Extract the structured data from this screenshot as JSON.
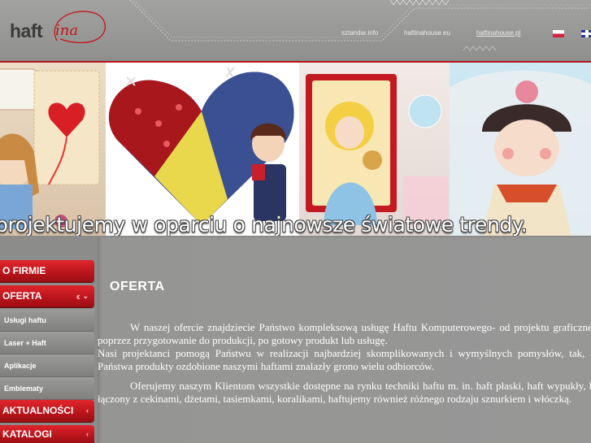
{
  "header": {
    "logo_word": "haft",
    "logo_script": "ina",
    "links": [
      "sztandar.info",
      "haftinahouse.eu",
      "haftinahouse.pl"
    ]
  },
  "banner": {
    "code": "09-030",
    "tagline": "projektujemy w oparciu o najnowsze światowe trendy."
  },
  "sidebar": {
    "items": [
      {
        "label": "O FIRMIE",
        "type": "main"
      },
      {
        "label": "OFERTA",
        "type": "main",
        "expanded": true
      },
      {
        "label": "Usługi haftu",
        "type": "sub"
      },
      {
        "label": "Laser + Haft",
        "type": "sub"
      },
      {
        "label": "Aplikacje",
        "type": "sub"
      },
      {
        "label": "Emblematy",
        "type": "sub"
      },
      {
        "label": "AKTUALNOŚCI",
        "type": "main"
      },
      {
        "label": "KATALOGI",
        "type": "main"
      }
    ]
  },
  "content": {
    "title": "OFERTA",
    "paragraphs": [
      "W naszej ofercie znajdziecie Państwo kompleksową usługę Haftu Komputerowego- od projektu graficznego, poprzez przygotowanie do produkcji, po gotowy produkt lub usługę.",
      "Nasi projektanci pomogą Państwu w realizacji najbardziej skomplikowanych i wymyślnych pomysłów, tak, aby Państwa produkty ozdobione naszymi haftami znalazły grono wielu odbiorców.",
      "Oferujemy naszym Klientom wszystkie dostępne na rynku techniki haftu m. in. haft płaski, haft wypukły, haft łączony z cekinami, dżetami, tasiemkami, koralikami, haftujemy również różnego rodzaju sznurkiem i włóczką."
    ]
  },
  "colors": {
    "accent_red": "#c4161c",
    "background_gray": "#8a8a89"
  }
}
